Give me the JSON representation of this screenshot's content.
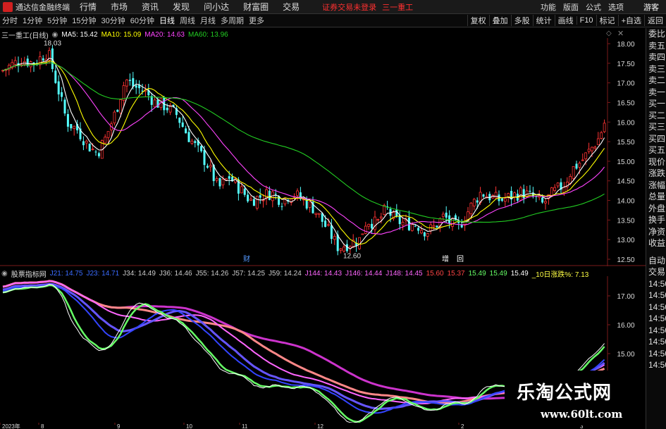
{
  "menubar": {
    "app_title": "通达信金融终端",
    "items": [
      "行情",
      "市场",
      "资讯",
      "发现",
      "问小达",
      "财富圈",
      "交易"
    ],
    "login_status": "证券交易未登录",
    "stock_name": "三一重工",
    "right_items": [
      "功能",
      "版面",
      "公式",
      "选项"
    ],
    "guest": "游客"
  },
  "periodbar": {
    "tabs": [
      "分时",
      "1分钟",
      "5分钟",
      "15分钟",
      "30分钟",
      "60分钟",
      "日线",
      "周线",
      "月线",
      "多周期",
      "更多"
    ],
    "active_tab": "日线",
    "tools": [
      "复权",
      "叠加",
      "多股",
      "统计",
      "画线",
      "F10",
      "标记",
      "+自选",
      "返回"
    ]
  },
  "main_legend": {
    "title": "三一重工(日线)",
    "ma5": "MA5: 15.42",
    "ma10": "MA10: 15.09",
    "ma20": "MA20: 14.63",
    "ma60": "MA60: 13.96"
  },
  "main_axis": {
    "ticks": [
      "18.00",
      "17.50",
      "17.00",
      "16.50",
      "16.00",
      "15.50",
      "15.00",
      "14.50",
      "14.00",
      "13.50",
      "13.00",
      "12.50"
    ]
  },
  "main_annotations": {
    "high": "18.03",
    "low": "12.60",
    "marker1": "财",
    "marker2": "增",
    "marker3": "回"
  },
  "sub_legend": {
    "title": "股票指标网",
    "items": [
      {
        "text": "J21: 14.75",
        "color": "#3a6bff"
      },
      {
        "text": "J23: 14.71",
        "color": "#3a6bff"
      },
      {
        "text": "J34: 14.49",
        "color": "#cccccc"
      },
      {
        "text": "J36: 14.46",
        "color": "#cccccc"
      },
      {
        "text": "J55: 14.26",
        "color": "#cccccc"
      },
      {
        "text": "J57: 14.25",
        "color": "#cccccc"
      },
      {
        "text": "J59: 14.24",
        "color": "#cccccc"
      },
      {
        "text": "J144: 14.43",
        "color": "#ff66ff"
      },
      {
        "text": "J146: 14.44",
        "color": "#ff66ff"
      },
      {
        "text": "J148: 14.45",
        "color": "#ff66ff"
      },
      {
        "text": "15.60",
        "color": "#ff4444"
      },
      {
        "text": "15.37",
        "color": "#ff4444"
      },
      {
        "text": "15.49",
        "color": "#66ff66"
      },
      {
        "text": "15.49",
        "color": "#66ff66"
      },
      {
        "text": "15.49",
        "color": "#ffffff"
      },
      {
        "text": "_10日涨跌%: 7.13",
        "color": "#ffff44"
      }
    ]
  },
  "sub_axis": {
    "ticks": [
      "17.00",
      "16.00",
      "15.00"
    ]
  },
  "dates": [
    "2023年",
    "8",
    "9",
    "10",
    "11",
    "12",
    "2",
    "3"
  ],
  "sidepanel": {
    "items1": [
      "委比",
      "卖五",
      "卖四",
      "卖三",
      "卖二",
      "卖一",
      "买一",
      "买二",
      "买三",
      "买四",
      "买五",
      "现价",
      "涨跌",
      "涨幅",
      "总量",
      "外盘",
      "换手",
      "净资",
      "收益"
    ],
    "items2": [
      "自动",
      "交易",
      "14:50",
      "14:50",
      "14:50",
      "14:50",
      "14:50",
      "14:50",
      "14:50",
      "14:50"
    ]
  },
  "watermark": {
    "title": "乐淘公式网",
    "url": "www.60lt.com"
  },
  "colors": {
    "up": "#ff3333",
    "down": "#54ffff",
    "ma5": "#ffffff",
    "ma10": "#ffff00",
    "ma20": "#ff44ff",
    "ma60": "#22cc22"
  }
}
